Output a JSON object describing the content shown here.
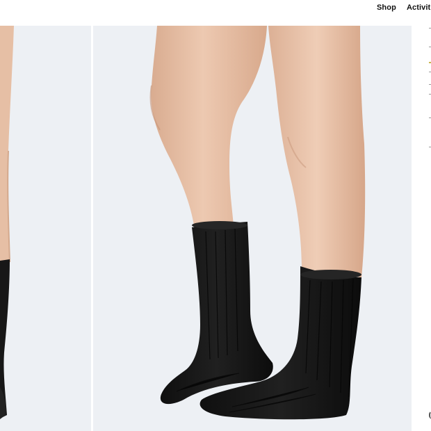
{
  "nav": {
    "items": [
      {
        "label": "Shop"
      },
      {
        "label": "Activiti"
      }
    ]
  },
  "gallery": {
    "panel_background": "#edf0f4",
    "sock_color": "#161616",
    "skin_color": "#e7c0a6"
  }
}
